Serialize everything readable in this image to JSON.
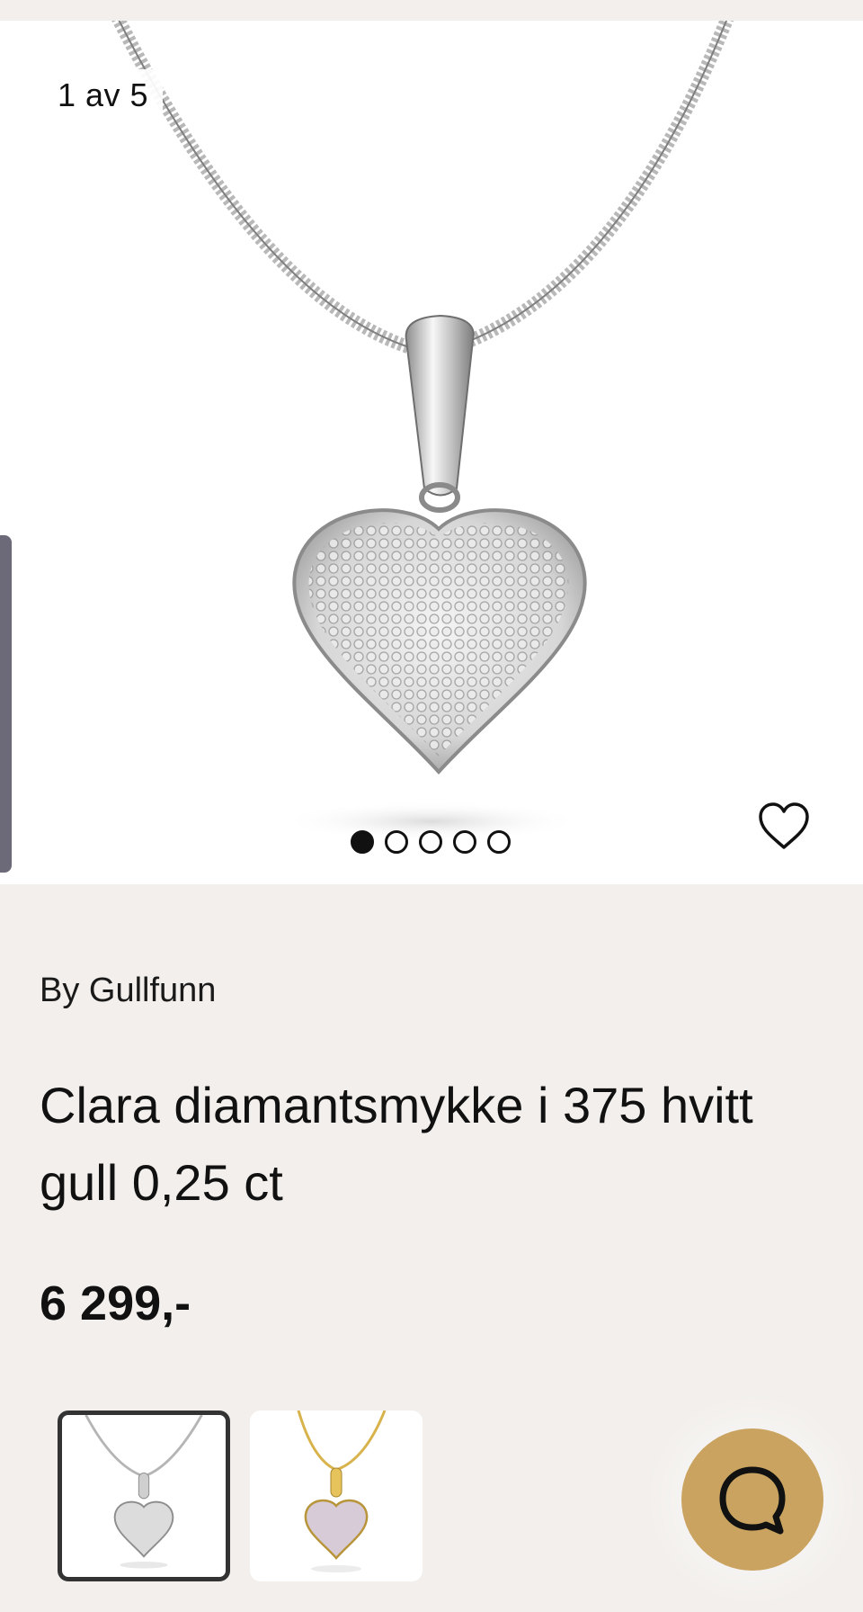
{
  "gallery": {
    "counter_text": "1 av 5",
    "dots_total": 5,
    "dots_active_index": 0
  },
  "product": {
    "brand": "By Gullfunn",
    "title": "Clara diamantsmykke i 375 hvitt gull 0,25 ct",
    "price": "6 299,-"
  },
  "variants": [
    {
      "name": "white-gold",
      "selected": true
    },
    {
      "name": "yellow-gold",
      "selected": false
    }
  ],
  "colors": {
    "background": "#f2efec",
    "chat_button": "#c9a35f",
    "text": "#111111"
  },
  "icons": {
    "favorite": "heart-outline-icon",
    "chat": "chat-bubble-icon"
  }
}
